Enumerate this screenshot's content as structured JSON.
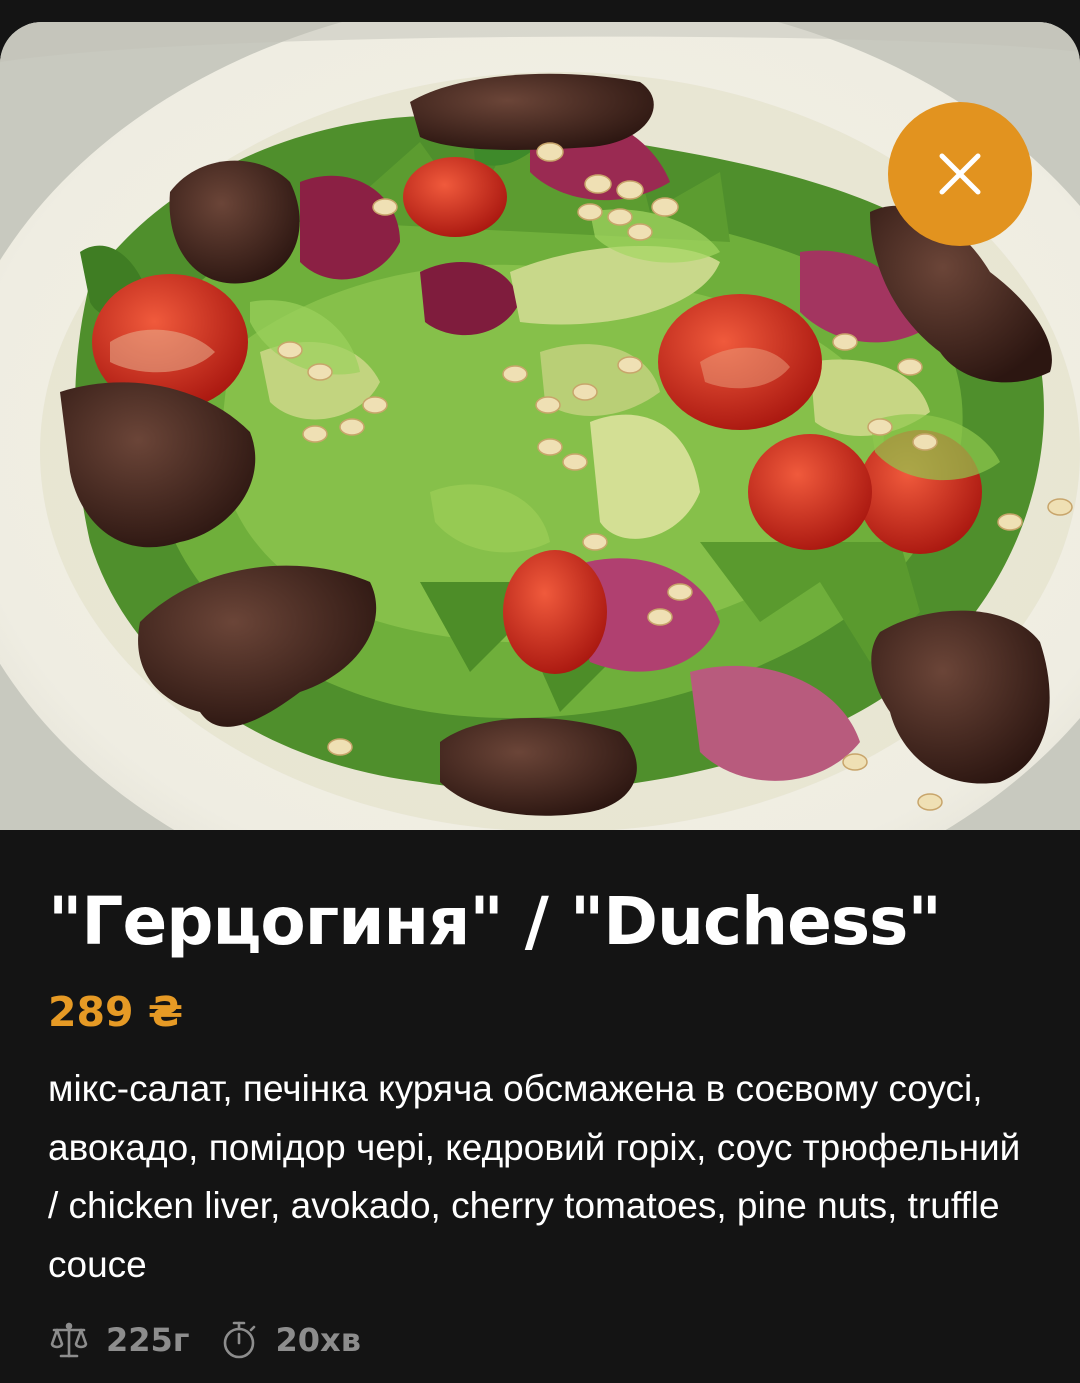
{
  "dish": {
    "photo_alt": "Салат \"Герцогиня\"",
    "title": "\"Герцогиня\" / \"Duchess\"",
    "price": "289 ₴",
    "description": "мікс-салат, печінка куряча обсмажена в соєвому соусі, авокадо, помідор чері, кедровий горіх, соус трюфельний / chicken liver, avokado, cherry tomatoes, pine nuts, truffle couce",
    "weight": "225г",
    "cook_time": "20хв"
  },
  "icons": {
    "close": "close-icon",
    "weight": "scale-icon",
    "time": "stopwatch-icon"
  },
  "colors": {
    "accent": "#e2931f",
    "price": "#e69a25",
    "background": "#141414",
    "text": "#ffffff",
    "muted": "#8d8d8d"
  }
}
